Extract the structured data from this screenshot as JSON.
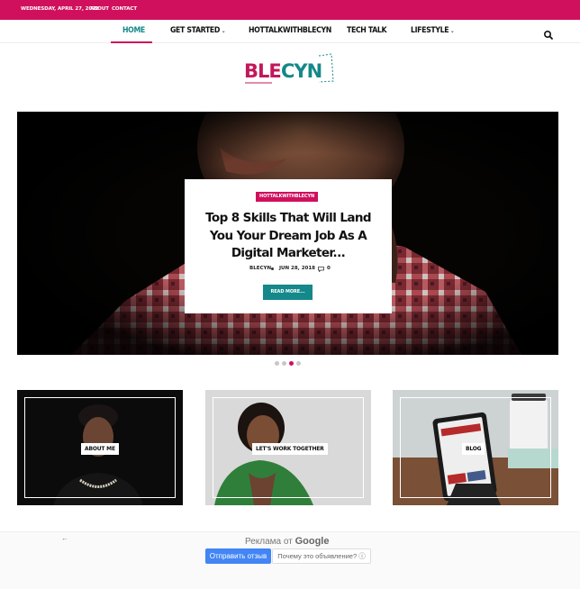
{
  "topbar": {
    "date": "WEDNESDAY, APRIL 27, 2022",
    "links": [
      "ABOUT",
      "CONTACT"
    ],
    "color": "#d0105d"
  },
  "nav": {
    "items": [
      {
        "label": "HOME",
        "active": true
      },
      {
        "label": "GET STARTED",
        "dropdown": true
      },
      {
        "label": "HOTTALKWITHBLECYN"
      },
      {
        "label": "TECH TALK"
      },
      {
        "label": "LIFESTYLE",
        "dropdown": true
      }
    ],
    "dropdown_glyph": "⌄",
    "search_icon": "search-icon"
  },
  "logo": {
    "text_ble": "BLE",
    "text_cyn": "CYN",
    "color_pink": "#c2185b",
    "color_teal": "#14888a"
  },
  "hero": {
    "category": "HOTTALKWITHBLECYN",
    "title": "Top 8 Skills That Will Land You Your Dream Job As A Digital Marketer...",
    "author": "BLECYN",
    "date": "JUN 28, 2018",
    "comments": "0",
    "read_more": "READ MORE...",
    "slider_count": 4,
    "active_slide": 2
  },
  "cards": [
    {
      "label": "ABOUT ME"
    },
    {
      "label": "LET'S WORK TOGETHER"
    },
    {
      "label": "BLOG"
    }
  ],
  "ad": {
    "back": "←",
    "prefix": "Реклама от ",
    "brand": "Google",
    "feedback_button": "Отправить отзыв",
    "why_button": "Почему это объявление? ⓘ"
  },
  "colors": {
    "accent": "#d0105d",
    "teal": "#14888a"
  }
}
